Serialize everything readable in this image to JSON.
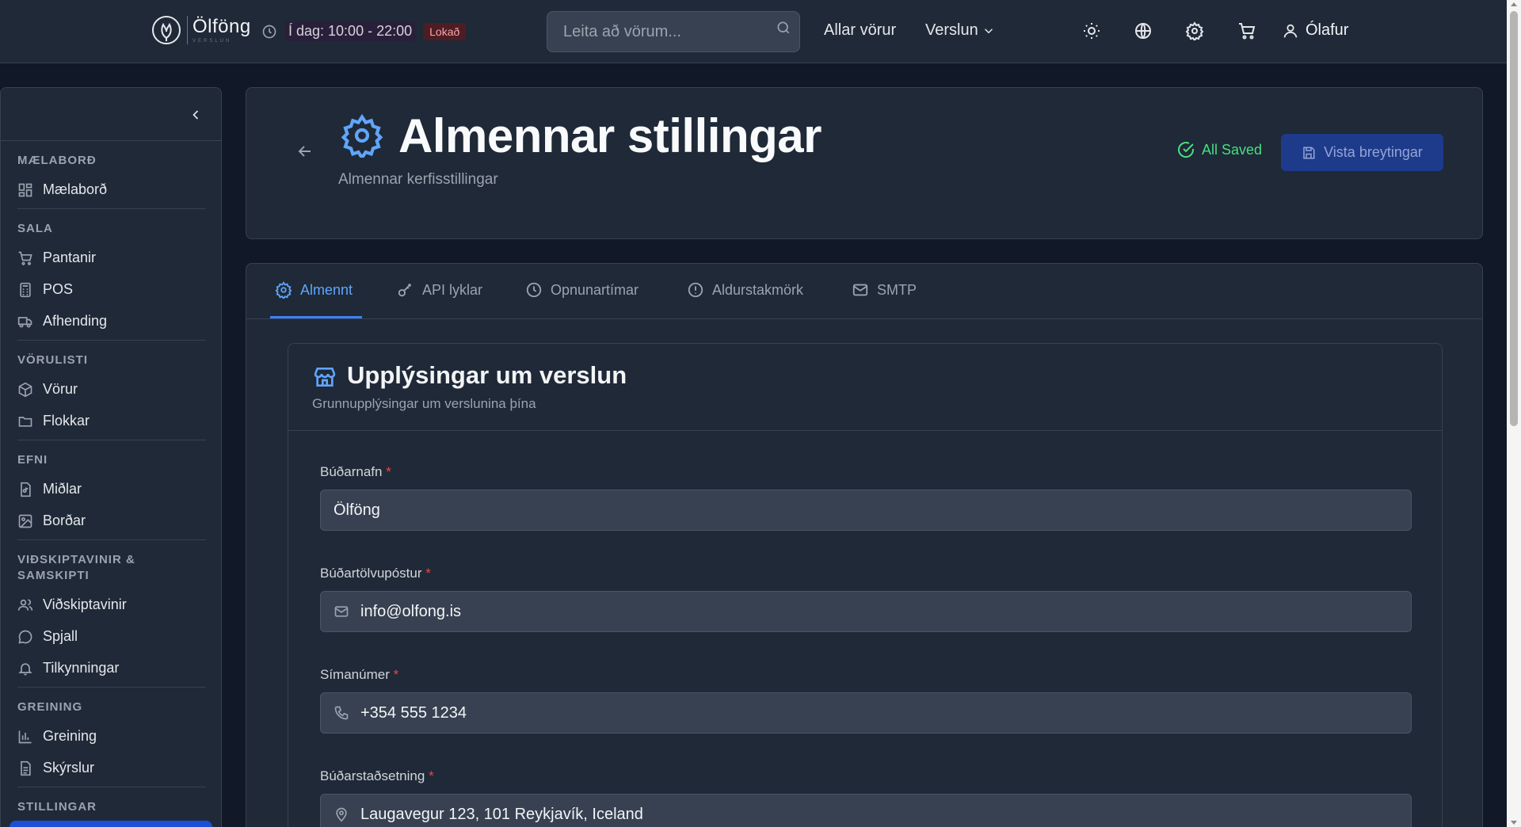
{
  "colors": {
    "background": "#111827",
    "surface": "#1f2937",
    "border": "#374151",
    "accent": "#3b82f6",
    "accent_text": "#60a5fa",
    "success": "#4ade80",
    "required": "#ef4444",
    "closed_badge": "#fca5a5"
  },
  "navbar": {
    "logo_icon": "hop-leaf-icon",
    "logo_name": "Ölföng",
    "logo_tagline": "VERSLUN",
    "hours_icon": "clock-icon",
    "hours_text": "Í dag: 10:00 - 22:00",
    "hours_badge": "Lokað",
    "search": {
      "placeholder": "Leita að vörum...",
      "icon": "search-icon"
    },
    "links": {
      "all_products": "Allar vörur",
      "store": "Verslun"
    },
    "icons": [
      "sun-icon",
      "globe-icon",
      "gear-icon",
      "cart-icon",
      "user-icon"
    ],
    "user_name": "Ólafur"
  },
  "sidebar": {
    "collapse_icon": "chevron-left-icon",
    "sections": [
      {
        "title": "MÆLABORÐ",
        "items": [
          {
            "label": "Mælaborð",
            "icon": "dashboard-grid-icon"
          }
        ]
      },
      {
        "title": "SALA",
        "items": [
          {
            "label": "Pantanir",
            "icon": "cart-icon"
          },
          {
            "label": "POS",
            "icon": "calculator-icon"
          },
          {
            "label": "Afhending",
            "icon": "truck-icon"
          }
        ]
      },
      {
        "title": "VÖRULISTI",
        "items": [
          {
            "label": "Vörur",
            "icon": "box-icon"
          },
          {
            "label": "Flokkar",
            "icon": "folder-icon"
          }
        ]
      },
      {
        "title": "EFNI",
        "items": [
          {
            "label": "Miðlar",
            "icon": "media-file-icon"
          },
          {
            "label": "Borðar",
            "icon": "image-icon"
          }
        ]
      },
      {
        "title": "VIÐSKIPTAVINIR & SAMSKIPTI",
        "items": [
          {
            "label": "Viðskiptavinir",
            "icon": "users-icon"
          },
          {
            "label": "Spjall",
            "icon": "chat-icon"
          },
          {
            "label": "Tilkynningar",
            "icon": "bell-icon"
          }
        ]
      },
      {
        "title": "GREINING",
        "items": [
          {
            "label": "Greining",
            "icon": "bar-chart-icon"
          },
          {
            "label": "Skýrslur",
            "icon": "report-icon"
          }
        ]
      },
      {
        "title": "STILLINGAR",
        "items": []
      }
    ]
  },
  "header": {
    "back_icon": "arrow-left-icon",
    "title_icon": "gear-icon",
    "title": "Almennar stillingar",
    "subtitle": "Almennar kerfisstillingar",
    "saved_status": "All Saved",
    "save_button": "Vista breytingar"
  },
  "tabs": [
    {
      "label": "Almennt",
      "icon": "gear-icon",
      "active": true
    },
    {
      "label": "API lyklar",
      "icon": "key-icon",
      "active": false
    },
    {
      "label": "Opnunartímar",
      "icon": "clock-icon",
      "active": false
    },
    {
      "label": "Aldurstakmörk",
      "icon": "alert-circle-icon",
      "active": false
    },
    {
      "label": "SMTP",
      "icon": "mail-icon",
      "active": false
    }
  ],
  "section": {
    "icon": "store-icon",
    "title": "Upplýsingar um verslun",
    "subtitle": "Grunnupplýsingar um verslunina þína",
    "required_marker": "*",
    "fields": [
      {
        "label": "Búðarnafn",
        "value": "Ölföng",
        "icon": null
      },
      {
        "label": "Búðartölvupóstur",
        "value": "info@olfong.is",
        "icon": "mail-icon"
      },
      {
        "label": "Símanúmer",
        "value": "+354 555 1234",
        "icon": "phone-icon"
      },
      {
        "label": "Búðarstaðsetning",
        "value": "Laugavegur 123, 101 Reykjavík, Iceland",
        "icon": "map-pin-icon"
      }
    ]
  }
}
